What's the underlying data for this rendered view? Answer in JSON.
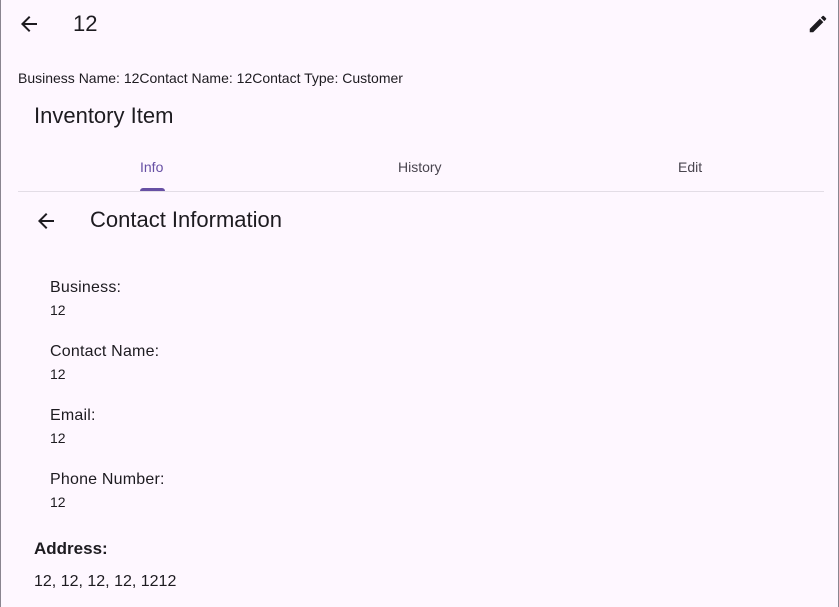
{
  "appbar": {
    "title": "12",
    "back_icon": "arrow-back-icon",
    "edit_icon": "pencil-edit-icon"
  },
  "summary": "Business Name: 12Contact Name: 12Contact Type: Customer",
  "section_title": "Inventory Item",
  "tabs": [
    {
      "label": "Info",
      "active": true
    },
    {
      "label": "History",
      "active": false
    },
    {
      "label": "Edit",
      "active": false
    }
  ],
  "contact": {
    "title": "Contact Information",
    "back_icon": "arrow-back-icon",
    "fields": [
      {
        "label": "Business:",
        "value": "12"
      },
      {
        "label": "Contact Name:",
        "value": "12"
      },
      {
        "label": "Email:",
        "value": "12"
      },
      {
        "label": "Phone Number:",
        "value": "12"
      }
    ],
    "address_label": "Address:",
    "address_value": "12, 12, 12, 12, 1212"
  },
  "colors": {
    "background": "#fef7ff",
    "accent": "#6750a4",
    "text": "#1d1b20",
    "muted_text": "#49454f",
    "divider": "#e3dde6"
  }
}
